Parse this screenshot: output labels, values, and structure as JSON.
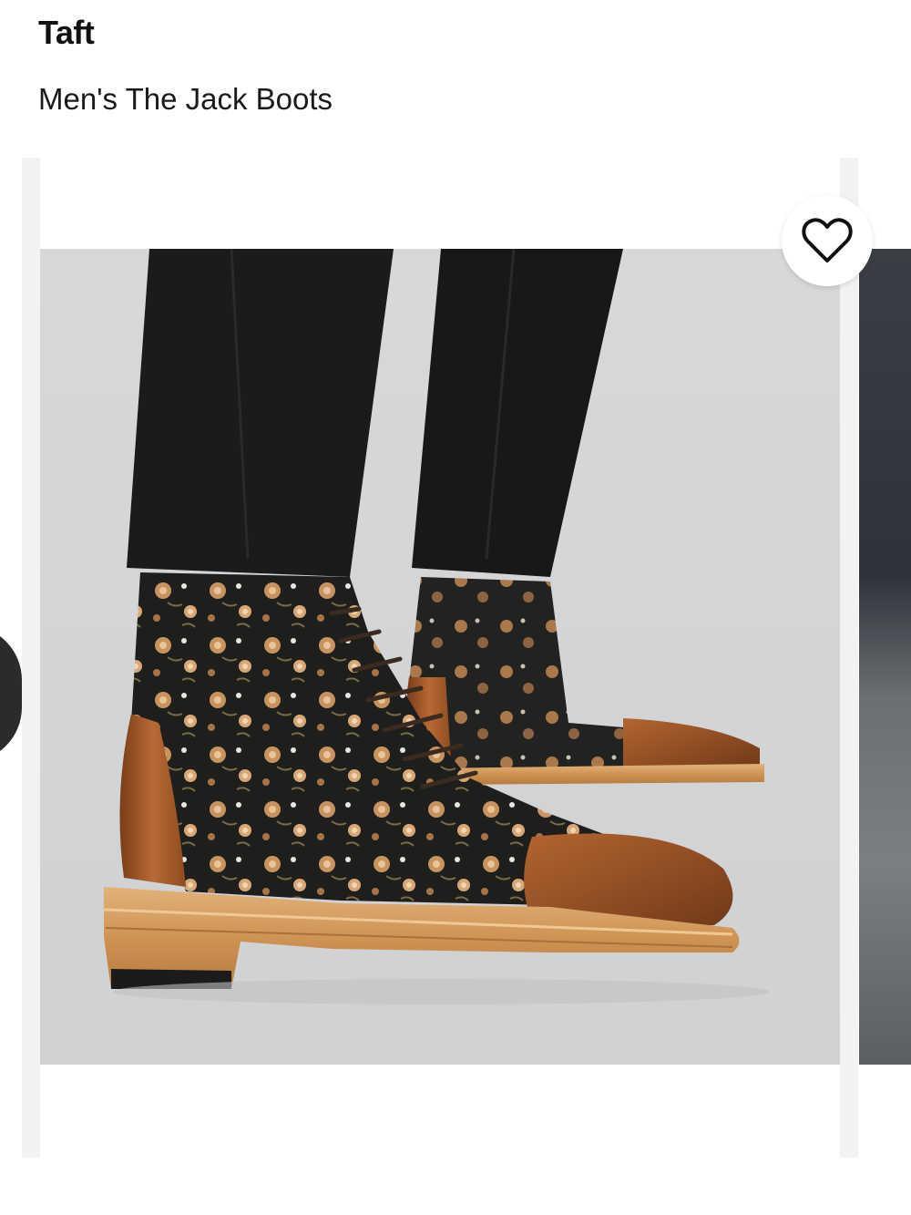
{
  "product": {
    "brand": "Taft",
    "name": "Men's The Jack Boots"
  },
  "icons": {
    "favorite": "heart-outline-icon",
    "previous": "chevron-left-icon"
  },
  "colors": {
    "image_background": "#d3d5d7",
    "trousers": "#1b1b1c",
    "leather_cap": "#9a5226",
    "sole": "#d49a5c",
    "floral_base": "#1e1f1d"
  }
}
